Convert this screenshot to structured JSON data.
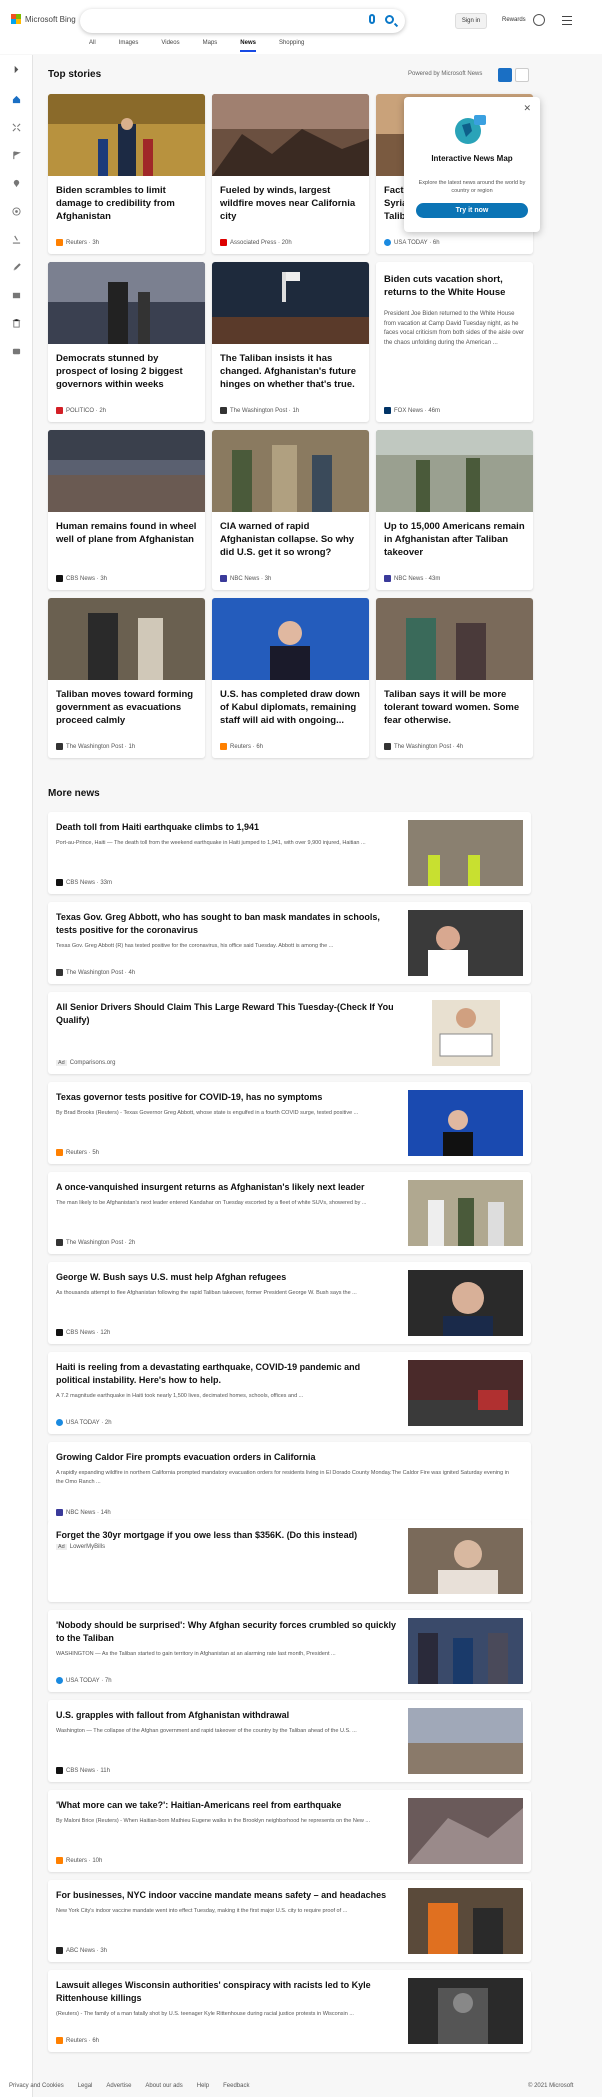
{
  "header": {
    "logo_text": "Microsoft Bing",
    "sign_in": "Sign in",
    "rewards": "Rewards",
    "tabs": [
      "All",
      "Images",
      "Videos",
      "Maps",
      "News",
      "Shopping"
    ]
  },
  "top_stories": {
    "title": "Top stories",
    "powered_by": "Powered by Microsoft News",
    "cards": [
      {
        "headline": "Biden scrambles to limit damage to credibility from Afghanistan",
        "source": "Reuters · 3h"
      },
      {
        "headline": "Fueled by winds, largest wildfire moves near California city",
        "source": "Associated Press · 20h"
      },
      {
        "headline": "Fact Syria Talib",
        "source": "USA TODAY · 6h"
      },
      {
        "headline": "Democrats stunned by prospect of losing 2 biggest governors within weeks",
        "source": "POLITICO · 2h"
      },
      {
        "headline": "The Taliban insists it has changed. Afghanistan's future hinges on whether that's true.",
        "source": "The Washington Post · 1h"
      },
      {
        "headline": "Biden cuts vacation short, returns to the White House",
        "snippet": "President Joe Biden returned to the White House from vacation at Camp David Tuesday night, as he faces vocal criticism from both sides of the aisle over the chaos unfolding during the American ...",
        "source": "FOX News · 46m"
      },
      {
        "headline": "Human remains found in wheel well of plane from Afghanistan",
        "source": "CBS News · 3h"
      },
      {
        "headline": "CIA warned of rapid Afghanistan collapse. So why did U.S. get it so wrong?",
        "source": "NBC News · 3h"
      },
      {
        "headline": "Up to 15,000 Americans remain in Afghanistan after Taliban takeover",
        "source": "NBC News · 43m"
      },
      {
        "headline": "Taliban moves toward forming government as evacuations proceed calmly",
        "source": "The Washington Post · 1h"
      },
      {
        "headline": "U.S. has completed draw down of Kabul diplomats, remaining staff will aid with ongoing...",
        "source": "Reuters · 6h"
      },
      {
        "headline": "Taliban says it will be more tolerant toward women. Some fear otherwise.",
        "source": "The Washington Post · 4h"
      }
    ]
  },
  "popup": {
    "title": "Interactive News Map",
    "description": "Explore the latest news around the world by country or region",
    "button": "Try it now"
  },
  "more_news": {
    "title": "More news",
    "items": [
      {
        "title": "Death toll from Haiti earthquake climbs to 1,941",
        "snippet": "Port-au-Prince, Haiti — The death toll from the weekend earthquake in Haiti jumped to 1,941, with over 9,900 injured, Haitian ...",
        "source": "CBS News · 33m"
      },
      {
        "title": "Texas Gov. Greg Abbott, who has sought to ban mask mandates in schools, tests positive for the coronavirus",
        "snippet": "Texas Gov. Greg Abbott (R) has tested positive for the coronavirus, his office said Tuesday. Abbott is among the ...",
        "source": "The Washington Post · 4h"
      },
      {
        "title": "All Senior Drivers Should Claim This Large Reward This Tuesday-(Check If You Qualify)",
        "snippet": "",
        "ad": "Ad",
        "source": "Comparisons.org"
      },
      {
        "title": "Texas governor tests positive for COVID-19, has no symptoms",
        "snippet": "By Brad Brooks (Reuters) - Texas Governor Greg Abbott, whose state is engulfed in a fourth COVID surge, tested positive ...",
        "source": "Reuters · 5h"
      },
      {
        "title": "A once-vanquished insurgent returns as Afghanistan's likely next leader",
        "snippet": "The man likely to be Afghanistan's next leader entered Kandahar on Tuesday escorted by a fleet of white SUVs, showered by ...",
        "source": "The Washington Post · 2h"
      },
      {
        "title": "George W. Bush says U.S. must help Afghan refugees",
        "snippet": "As thousands attempt to flee Afghanistan following the rapid Taliban takeover, former President George W. Bush says the ...",
        "source": "CBS News · 12h"
      },
      {
        "title": "Haiti is reeling from a devastating earthquake, COVID-19 pandemic and political instability. Here's how to help.",
        "snippet": "A 7.2 magnitude earthquake in Haiti took nearly 1,500 lives, decimated homes, schools, offices and ...",
        "source": "USA TODAY · 2h"
      },
      {
        "title": "Growing Caldor Fire prompts evacuation orders in California",
        "snippet": "A rapidly expanding wildfire in northern California prompted mandatory evacuation orders for residents living in El Dorado County Monday.The Caldor Fire was ignited Saturday evening in the Omo Ranch ...",
        "source": "NBC News · 14h"
      },
      {
        "title": "Forget the 30yr mortgage if you owe less than $356K. (Do this instead)",
        "snippet": "",
        "ad": "Ad",
        "source": "LowerMyBills"
      },
      {
        "title": "'Nobody should be surprised': Why Afghan security forces crumbled so quickly to the Taliban",
        "snippet": "WASHINGTON — As the Taliban started to gain territory in Afghanistan at an alarming rate last month, President ...",
        "source": "USA TODAY · 7h"
      },
      {
        "title": "U.S. grapples with fallout from Afghanistan withdrawal",
        "snippet": "Washington — The collapse of the Afghan government and rapid takeover of the country by the Taliban ahead of the U.S. ...",
        "source": "CBS News · 11h"
      },
      {
        "title": "'What more can we take?': Haitian-Americans reel from earthquake",
        "snippet": "By Maloni Brice (Reuters) - When Haitian-born Mathieu Eugene walks in the Brooklyn neighborhood he represents on the New ...",
        "source": "Reuters · 10h"
      },
      {
        "title": "For businesses, NYC indoor vaccine mandate means safety – and headaches",
        "snippet": "New York City's indoor vaccine mandate went into effect Tuesday, making it the first major U.S. city to require proof of ...",
        "source": "ABC News · 3h"
      },
      {
        "title": "Lawsuit alleges Wisconsin authorities' conspiracy with racists led to Kyle Rittenhouse killings",
        "snippet": "(Reuters) - The family of a man fatally shot by U.S. teenager Kyle Rittenhouse during racial justice protests in Wisconsin ...",
        "source": "Reuters · 6h"
      }
    ]
  },
  "footer": {
    "links": [
      "Privacy and Cookies",
      "Legal",
      "Advertise",
      "About our ads",
      "Help",
      "Feedback"
    ],
    "copyright": "© 2021 Microsoft"
  }
}
